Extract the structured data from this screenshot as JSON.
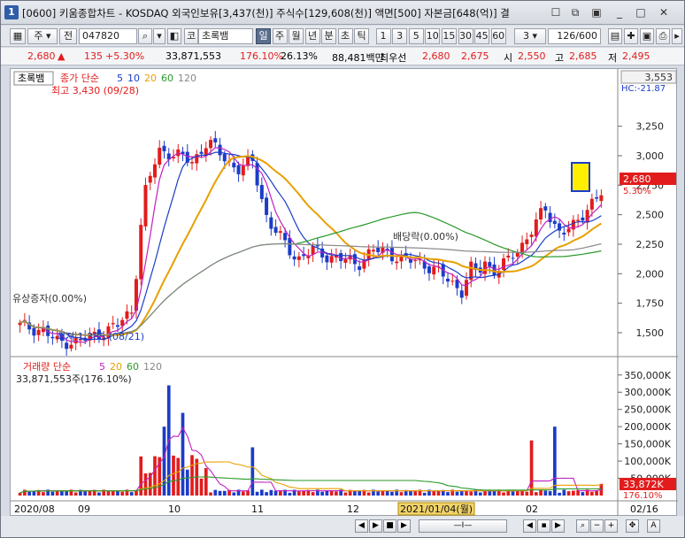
{
  "window": {
    "number": "1",
    "title": "[0600] 키움종합차트 - KOSDAQ 외국인보유[3,437(천)] 주식수[129,608(천)] 액면[500] 자본금[648(억)] 결"
  },
  "toolbar": {
    "market": "주",
    "prev": "전",
    "code": "047820",
    "code_type": "코",
    "stock_name": "초록뱀",
    "periods": [
      "일",
      "주",
      "월",
      "년",
      "분",
      "초",
      "틱"
    ],
    "selected_period": "일",
    "minutes": [
      "1",
      "3",
      "5",
      "10",
      "15",
      "30",
      "45",
      "60"
    ],
    "interval": "3",
    "count": "126/600"
  },
  "info": {
    "price": "2,680",
    "change_sign": "▲",
    "change": "135",
    "change_pct": "+5.30%",
    "volume": "33,871,553",
    "vol_ratio": "176.10%",
    "turnover": "26.13%",
    "amount": "88,481백만",
    "priority_label": "최우선",
    "ask": "2,680",
    "bid": "2,675",
    "open_label": "시",
    "open": "2,550",
    "high_label": "고",
    "high": "2,685",
    "low_label": "저",
    "low": "2,495"
  },
  "chart_data": [
    {
      "type": "candlestick",
      "title": "초록뱀",
      "legend": {
        "price_label": "종가",
        "ma_label": "단순",
        "periods": [
          "5",
          "10",
          "20",
          "60",
          "120"
        ]
      },
      "ylim": [
        1350,
        3630
      ],
      "yticks": [
        "3,250",
        "3,000",
        "2,750",
        "2,500",
        "2,250",
        "2,000",
        "1,750",
        "1,500"
      ],
      "xlabels": [
        "2020/08",
        "09",
        "10",
        "11",
        "12",
        "2021/01/04(월)",
        "02",
        "02/16"
      ],
      "last_price": "2,680",
      "last_change": "5.30%",
      "top_value": "3,553",
      "hc_label": "HC:-21.87",
      "annotations": {
        "high": "최고 3,430 (09/28)",
        "low": "최저 1,385 (08/21)",
        "capital": "유상증자(0.00%)",
        "dividend": "배당락(0.00%)"
      }
    },
    {
      "type": "bar",
      "title": "거래량",
      "legend": {
        "ma_label": "단순",
        "periods": [
          "5",
          "20",
          "60",
          "120"
        ]
      },
      "current": "33,871,553주(176.10%)",
      "ylim": [
        0,
        370000
      ],
      "yticks": [
        "350,000K",
        "300,000K",
        "250,000K",
        "200,000K",
        "150,000K",
        "100,000K",
        "50,000K"
      ],
      "last_value": "33,872K",
      "last_pct": "176.10%"
    }
  ]
}
